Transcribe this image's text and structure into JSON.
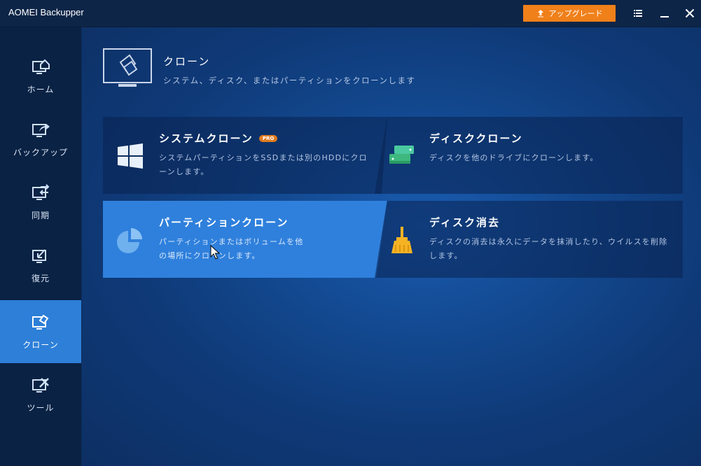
{
  "app": {
    "title": "AOMEI Backupper"
  },
  "titlebar": {
    "upgrade_label": "アップグレード"
  },
  "sidebar": {
    "items": [
      {
        "label": "ホーム",
        "icon": "home-monitor-icon"
      },
      {
        "label": "バックアップ",
        "icon": "backup-monitor-icon"
      },
      {
        "label": "同期",
        "icon": "sync-monitor-icon"
      },
      {
        "label": "復元",
        "icon": "restore-monitor-icon"
      },
      {
        "label": "クローン",
        "icon": "clone-monitor-icon",
        "active": true
      },
      {
        "label": "ツール",
        "icon": "tools-monitor-icon"
      }
    ]
  },
  "header": {
    "title": "クローン",
    "subtitle": "システム、ディスク、またはパーティションをクローンします"
  },
  "cards": [
    {
      "title": "システムクローン",
      "badge": "PRO",
      "desc": "システムパーティションをSSDまたは別のHDDにクローンします。",
      "icon": "windows-logo-icon"
    },
    {
      "title": "ディスククローン",
      "desc": "ディスクを他のドライブにクローンします。",
      "icon": "disk-drives-icon"
    },
    {
      "title": "パーティションクローン",
      "desc": "パーティションまたはボリュームを他の場所にクローンします。",
      "icon": "pie-partition-icon",
      "highlighted": true
    },
    {
      "title": "ディスク消去",
      "desc": "ディスクの消去は永久にデータを抹消したり、ウイルスを削除します。",
      "icon": "broom-icon"
    }
  ],
  "colors": {
    "accent": "#2d7fd8",
    "upgrade": "#f0801a",
    "sidebar": "#0a2244",
    "titlebar": "#0d2547"
  }
}
